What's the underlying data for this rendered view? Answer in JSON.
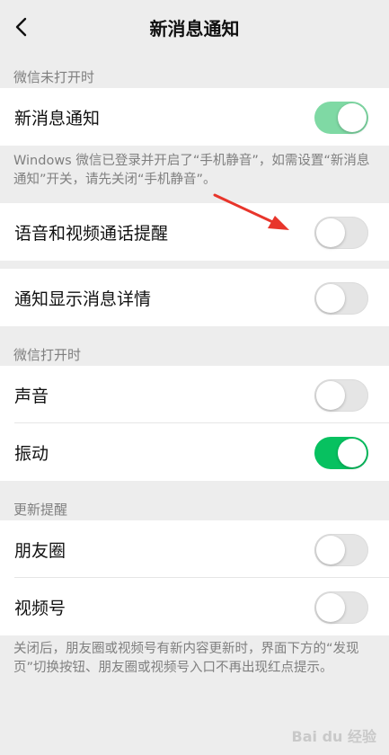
{
  "header": {
    "back_icon": "chevron-left-icon",
    "title": "新消息通知"
  },
  "section_wechat_closed": {
    "caption": "微信未打开时",
    "new_message": {
      "label": "新消息通知",
      "toggle_on": true
    },
    "note": "Windows 微信已登录并开启了“手机静音”，如需设置“新消息通知”开关，请先关闭“手机静音”。"
  },
  "voice_video_call": {
    "label": "语音和视频通话提醒",
    "toggle_on": false
  },
  "show_details": {
    "label": "通知显示消息详情",
    "toggle_on": false
  },
  "section_wechat_open": {
    "caption": "微信打开时",
    "sound": {
      "label": "声音",
      "toggle_on": false
    },
    "vibrate": {
      "label": "振动",
      "toggle_on": true
    }
  },
  "section_updates": {
    "caption": "更新提醒",
    "moments": {
      "label": "朋友圈",
      "toggle_on": false
    },
    "channels": {
      "label": "视频号",
      "toggle_on": false
    },
    "note": "关闭后，朋友圈或视频号有新内容更新时，界面下方的“发现页”切换按钮、朋友圈或视频号入口不再出现红点提示。"
  },
  "watermark": "Bai du 经验",
  "colors": {
    "background": "#ededed",
    "toggle_on": "#07c160",
    "toggle_on_disabled": "#7fd9a4",
    "toggle_off": "#e5e5e5",
    "annotation_arrow": "#e8352b"
  }
}
